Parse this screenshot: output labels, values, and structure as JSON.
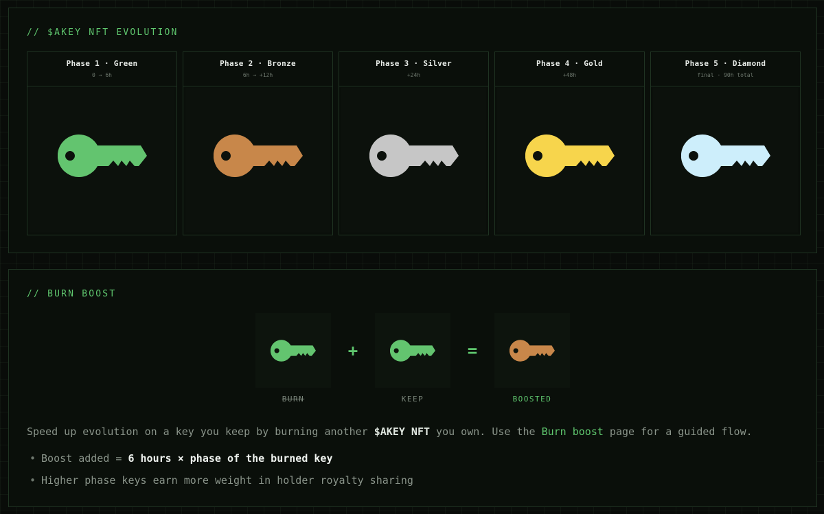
{
  "evolution": {
    "title": "// $AKEY NFT EVOLUTION",
    "phases": [
      {
        "name": "Phase 1 · Green",
        "timing": "0 → 6h",
        "color": "#63c46f"
      },
      {
        "name": "Phase 2 · Bronze",
        "timing": "6h → +12h",
        "color": "#c8874a"
      },
      {
        "name": "Phase 3 · Silver",
        "timing": "+24h",
        "color": "#c6c6c6"
      },
      {
        "name": "Phase 4 · Gold",
        "timing": "+48h",
        "color": "#f7d54c"
      },
      {
        "name": "Phase 5 · Diamond",
        "timing": "final · 90h total",
        "color": "#cdeefb"
      }
    ]
  },
  "burn_boost": {
    "title": "// BURN BOOST",
    "items": [
      {
        "label": "BURN",
        "color": "#63c46f"
      },
      {
        "label": "KEEP",
        "color": "#63c46f"
      },
      {
        "label": "BOOSTED",
        "color": "#c8874a"
      }
    ],
    "plus": "+",
    "equals": "=",
    "description": {
      "part1": "Speed up evolution on a key you keep by burning another ",
      "token": "$AKEY NFT",
      "part2": " you own. Use the ",
      "link": "Burn boost",
      "part3": " page for a guided flow."
    },
    "bullets": {
      "b1_prefix": "Boost added = ",
      "b1_strong": "6 hours × phase of the burned key",
      "b2": "Higher phase keys earn more weight in holder royalty sharing"
    },
    "bullet_glyph": "•"
  },
  "colors": {
    "accent": "#5fc66e",
    "background": "#090c09"
  }
}
